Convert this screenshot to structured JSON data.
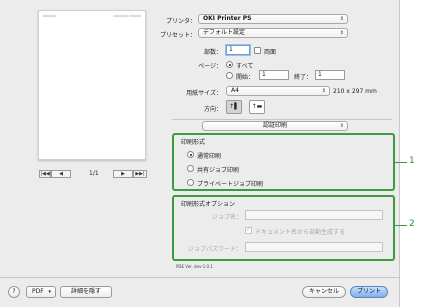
{
  "preview": {
    "header_left": "OKIDATA",
    "header_right": "XXXXXXX XXXXXX",
    "page_indicator": "1/1",
    "nav_first": "|◀◀",
    "nav_prev": "◀",
    "nav_next": "▶",
    "nav_last": "▶▶|"
  },
  "printer": {
    "label": "プリンタ：",
    "value": "OKI Printer PS"
  },
  "preset": {
    "label": "プリセット：",
    "value": "デフォルト設定"
  },
  "copies": {
    "label": "部数：",
    "value": "1",
    "duplex_label": "両面"
  },
  "pages": {
    "label": "ページ：",
    "all_label": "すべて",
    "from_label": "開始：",
    "from_value": "1",
    "to_label": "終了：",
    "to_value": "1"
  },
  "paper": {
    "label": "用紙サイズ：",
    "value": "A4",
    "dimensions": "210 x 297 mm"
  },
  "orientation": {
    "label": "方向：",
    "portrait_glyph": "↑▌",
    "landscape_glyph": "↑▬"
  },
  "panel_select": {
    "value": "認証印刷"
  },
  "print_mode": {
    "title": "印刷形式",
    "options": [
      "通常印刷",
      "共有ジョブ印刷",
      "プライベートジョブ印刷"
    ]
  },
  "print_options": {
    "title": "印刷形式オプション",
    "job_name_label": "ジョブ名：",
    "auto_generate_label": "ドキュメント名から自動生成する",
    "password_label": "ジョブパスワード："
  },
  "pde_version": "PDE Ver. dev-1.0.1",
  "footer": {
    "help": "?",
    "pdf_label": "PDF",
    "hide_details": "詳細を隠す",
    "cancel": "キャンセル",
    "print": "プリント"
  },
  "callouts": {
    "one": "1",
    "two": "2"
  },
  "colors": {
    "highlight": "#3d9b3d",
    "primary_button": "#7fb0ee",
    "dialog_bg": "#ececec"
  }
}
